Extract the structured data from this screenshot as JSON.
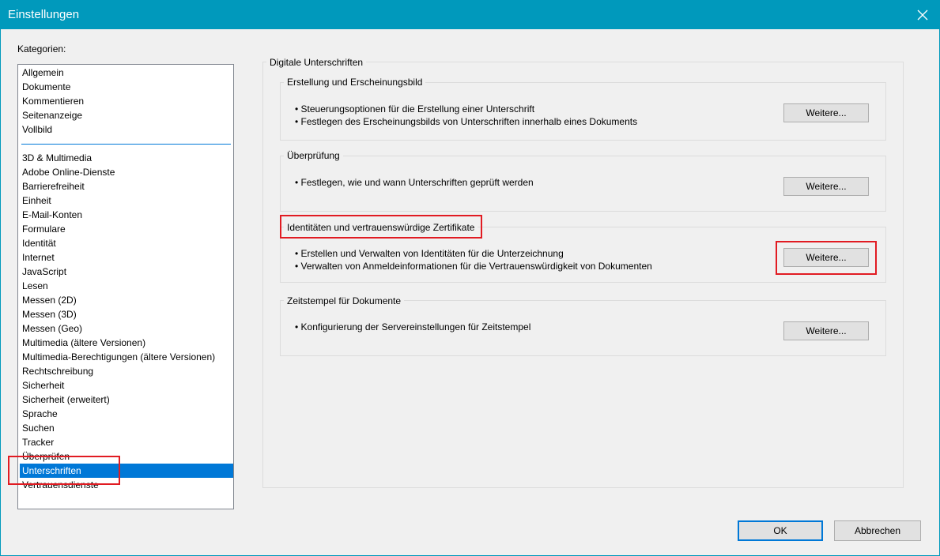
{
  "window": {
    "title": "Einstellungen"
  },
  "categories": {
    "label": "Kategorien:",
    "group1": [
      "Allgemein",
      "Dokumente",
      "Kommentieren",
      "Seitenanzeige",
      "Vollbild"
    ],
    "group2": [
      "3D & Multimedia",
      "Adobe Online-Dienste",
      "Barrierefreiheit",
      "Einheit",
      "E-Mail-Konten",
      "Formulare",
      "Identität",
      "Internet",
      "JavaScript",
      "Lesen",
      "Messen (2D)",
      "Messen (3D)",
      "Messen (Geo)",
      "Multimedia (ältere Versionen)",
      "Multimedia-Berechtigungen (ältere Versionen)",
      "Rechtschreibung",
      "Sicherheit",
      "Sicherheit (erweitert)",
      "Sprache",
      "Suchen",
      "Tracker",
      "Überprüfen",
      "Unterschriften",
      "Vertrauensdienste"
    ],
    "selected": "Unterschriften"
  },
  "panel": {
    "title": "Digitale Unterschriften",
    "sections": [
      {
        "title": "Erstellung und Erscheinungsbild",
        "bullets": [
          "• Steuerungsoptionen für die Erstellung einer Unterschrift",
          "• Festlegen des Erscheinungsbilds von Unterschriften innerhalb eines Dokuments"
        ],
        "button": "Weitere..."
      },
      {
        "title": "Überprüfung",
        "bullets": [
          "• Festlegen, wie und wann Unterschriften geprüft werden"
        ],
        "button": "Weitere..."
      },
      {
        "title": "Identitäten und vertrauenswürdige Zertifikate",
        "bullets": [
          "• Erstellen und Verwalten von Identitäten für die Unterzeichnung",
          "• Verwalten von Anmeldeinformationen für die Vertrauenswürdigkeit von Dokumenten"
        ],
        "button": "Weitere..."
      },
      {
        "title": "Zeitstempel für Dokumente",
        "bullets": [
          "• Konfigurierung der Servereinstellungen für Zeitstempel"
        ],
        "button": "Weitere..."
      }
    ]
  },
  "footer": {
    "ok": "OK",
    "cancel": "Abbrechen"
  },
  "colors": {
    "titlebar": "#0099bc",
    "selection": "#0078d7",
    "highlight": "#e11b22"
  }
}
